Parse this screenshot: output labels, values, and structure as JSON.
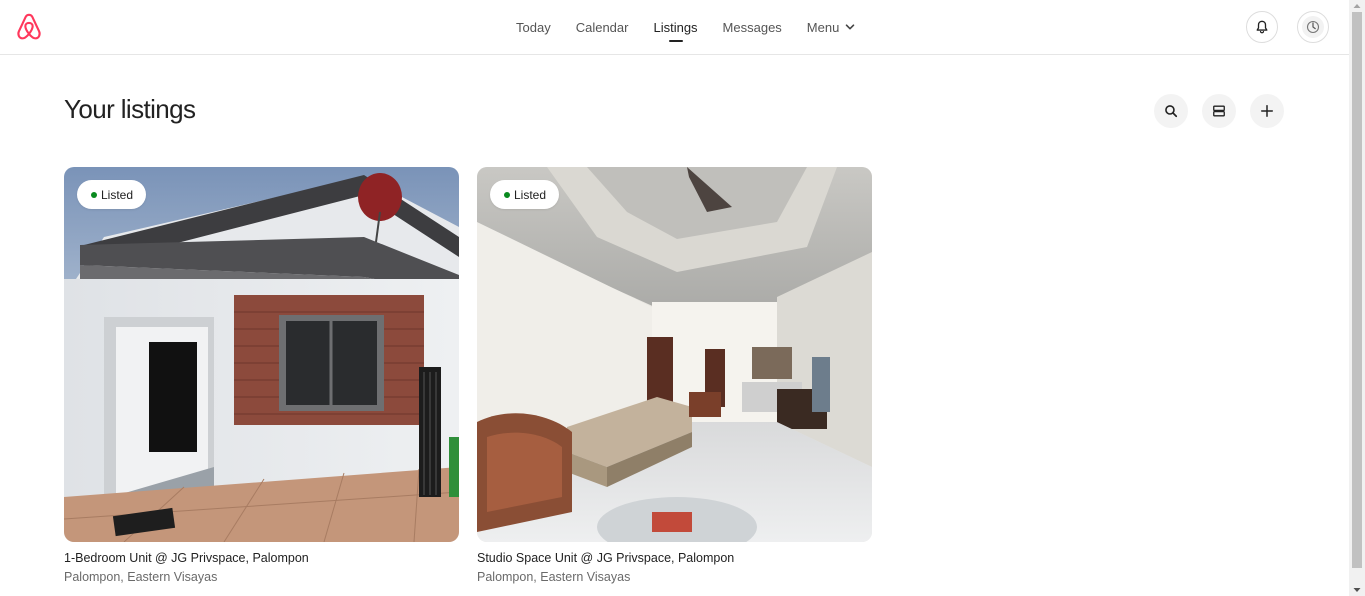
{
  "header": {
    "nav": [
      {
        "label": "Today"
      },
      {
        "label": "Calendar"
      },
      {
        "label": "Listings"
      },
      {
        "label": "Messages"
      },
      {
        "label": "Menu"
      }
    ],
    "active_tab": "Listings"
  },
  "colors": {
    "brand": "#ff385c",
    "listed_dot": "#0a8a1f"
  },
  "main": {
    "title": "Your listings",
    "tools": [
      "search-icon",
      "list-view-icon",
      "plus-icon"
    ]
  },
  "listings": [
    {
      "status": "Listed",
      "title": "1-Bedroom Unit @ JG Privspace, Palompon",
      "location": "Palompon, Eastern Visayas"
    },
    {
      "status": "Listed",
      "title": "Studio Space Unit @ JG Privspace, Palompon",
      "location": "Palompon, Eastern Visayas"
    }
  ]
}
